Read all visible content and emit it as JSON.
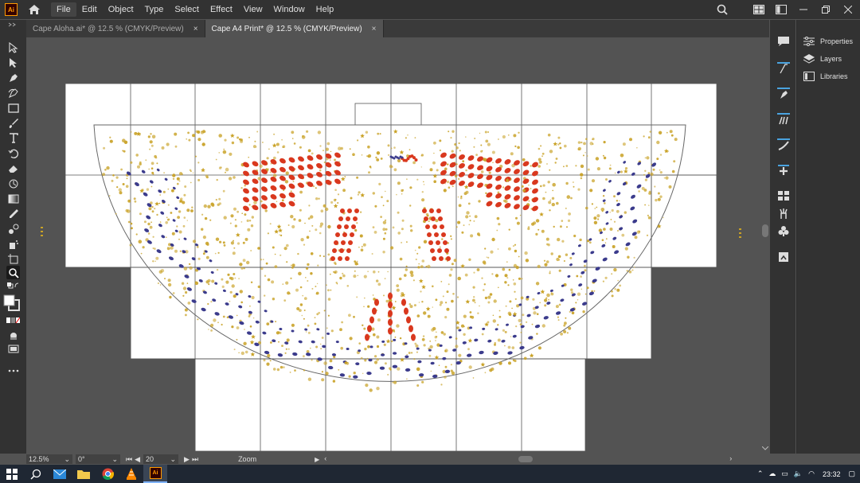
{
  "app": {
    "logo": "Ai"
  },
  "menu": [
    "File",
    "Edit",
    "Object",
    "Type",
    "Select",
    "Effect",
    "View",
    "Window",
    "Help"
  ],
  "tabs": [
    {
      "label": "Cape Aloha.ai* @ 12.5 % (CMYK/Preview)",
      "close": "×",
      "active": false
    },
    {
      "label": "Cape A4 Print* @ 12.5 % (CMYK/Preview)",
      "close": "×",
      "active": true
    }
  ],
  "panels": [
    {
      "label": "Properties",
      "icon": "properties-icon"
    },
    {
      "label": "Layers",
      "icon": "layers-icon"
    },
    {
      "label": "Libraries",
      "icon": "libraries-icon"
    }
  ],
  "status": {
    "zoom": "12.5%",
    "rotation": "0°",
    "artboard": "20",
    "tool": "Zoom"
  },
  "taskbar": {
    "time": "23:32"
  },
  "colors": {
    "blue": "#3b3b8c",
    "red": "#d9381e",
    "gold": "#c9a227"
  }
}
